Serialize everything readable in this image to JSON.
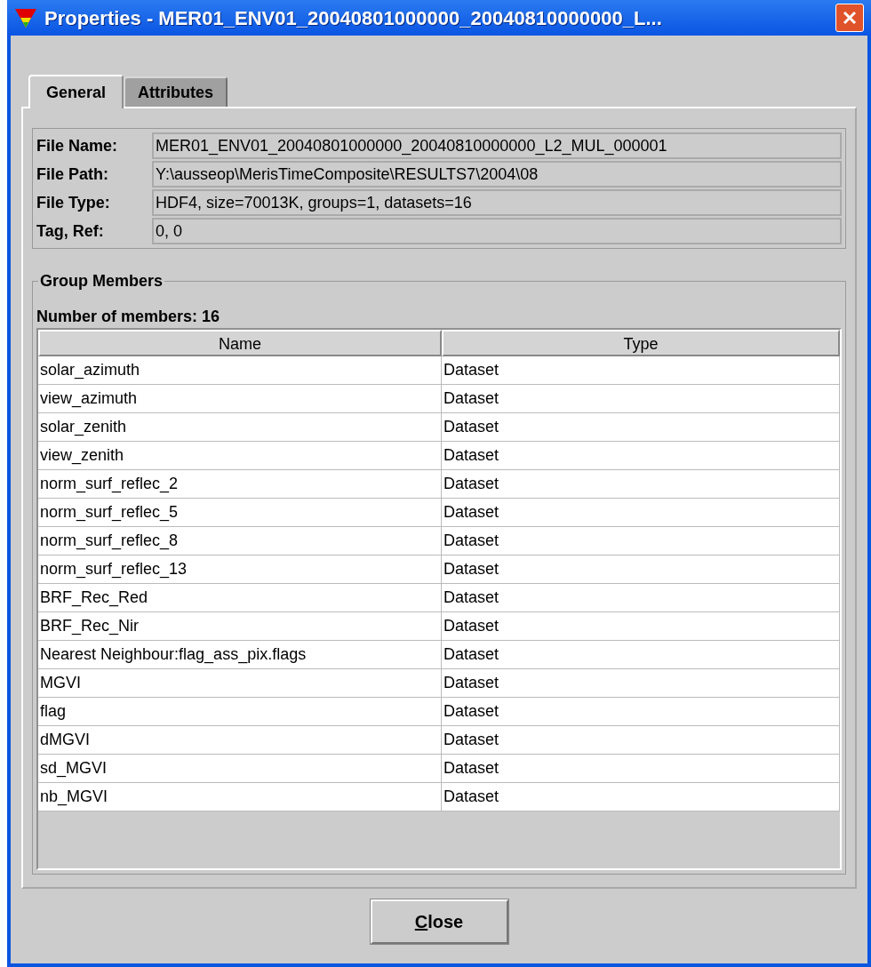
{
  "window": {
    "title": "Properties - MER01_ENV01_20040801000000_20040810000000_L..."
  },
  "tabs": [
    {
      "label": "General",
      "selected": true
    },
    {
      "label": "Attributes",
      "selected": false
    }
  ],
  "file_info": [
    {
      "label": "File Name:",
      "value": "MER01_ENV01_20040801000000_20040810000000_L2_MUL_000001"
    },
    {
      "label": "File Path:",
      "value": "Y:\\ausseop\\MerisTimeComposite\\RESULTS7\\2004\\08"
    },
    {
      "label": "File Type:",
      "value": "HDF4,  size=70013K,  groups=1,  datasets=16"
    },
    {
      "label": "Tag, Ref:",
      "value": "0, 0"
    }
  ],
  "group_members": {
    "title": "Group Members",
    "count_label": "Number of members: 16",
    "table": {
      "columns": [
        "Name",
        "Type"
      ],
      "rows": [
        [
          "solar_azimuth",
          "Dataset"
        ],
        [
          "view_azimuth",
          "Dataset"
        ],
        [
          "solar_zenith",
          "Dataset"
        ],
        [
          "view_zenith",
          "Dataset"
        ],
        [
          "norm_surf_reflec_2",
          "Dataset"
        ],
        [
          "norm_surf_reflec_5",
          "Dataset"
        ],
        [
          "norm_surf_reflec_8",
          "Dataset"
        ],
        [
          "norm_surf_reflec_13",
          "Dataset"
        ],
        [
          "BRF_Rec_Red",
          "Dataset"
        ],
        [
          "BRF_Rec_Nir",
          "Dataset"
        ],
        [
          "Nearest Neighbour:flag_ass_pix.flags",
          "Dataset"
        ],
        [
          "MGVI",
          "Dataset"
        ],
        [
          "flag",
          "Dataset"
        ],
        [
          "dMGVI",
          "Dataset"
        ],
        [
          "sd_MGVI",
          "Dataset"
        ],
        [
          "nb_MGVI",
          "Dataset"
        ]
      ]
    }
  },
  "buttons": [
    {
      "label": "Close"
    }
  ]
}
